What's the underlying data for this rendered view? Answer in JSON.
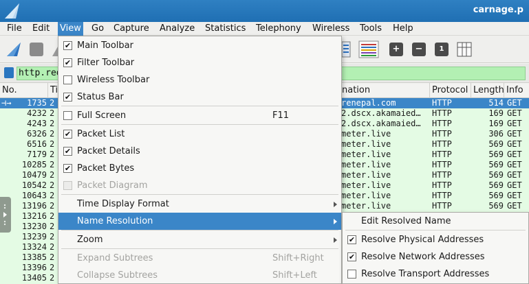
{
  "window": {
    "title": "carnage.p"
  },
  "menubar": {
    "items": [
      "File",
      "Edit",
      "View",
      "Go",
      "Capture",
      "Analyze",
      "Statistics",
      "Telephony",
      "Wireless",
      "Tools",
      "Help"
    ]
  },
  "filter": {
    "value": "http.requ"
  },
  "columns": {
    "no": "No.",
    "time": "Ti",
    "destination": "nation",
    "protocol": "Protocol",
    "length": "Length",
    "info": "Info"
  },
  "packets": [
    {
      "no": "1735",
      "time": "2",
      "dest": "renepal.com",
      "proto": "HTTP",
      "len": "514",
      "info": "GET"
    },
    {
      "no": "4232",
      "time": "2",
      "dest": "2.dscx.akamaied…",
      "proto": "HTTP",
      "len": "169",
      "info": "GET"
    },
    {
      "no": "4243",
      "time": "2",
      "dest": "2.dscx.akamaied…",
      "proto": "HTTP",
      "len": "169",
      "info": "GET"
    },
    {
      "no": "6326",
      "time": "2",
      "dest": "meter.live",
      "proto": "HTTP",
      "len": "306",
      "info": "GET"
    },
    {
      "no": "6516",
      "time": "2",
      "dest": "meter.live",
      "proto": "HTTP",
      "len": "569",
      "info": "GET"
    },
    {
      "no": "7179",
      "time": "2",
      "dest": "meter.live",
      "proto": "HTTP",
      "len": "569",
      "info": "GET"
    },
    {
      "no": "10285",
      "time": "2",
      "dest": "meter.live",
      "proto": "HTTP",
      "len": "569",
      "info": "GET"
    },
    {
      "no": "10479",
      "time": "2",
      "dest": "meter.live",
      "proto": "HTTP",
      "len": "569",
      "info": "GET"
    },
    {
      "no": "10542",
      "time": "2",
      "dest": "meter.live",
      "proto": "HTTP",
      "len": "569",
      "info": "GET"
    },
    {
      "no": "10643",
      "time": "2",
      "dest": "meter.live",
      "proto": "HTTP",
      "len": "569",
      "info": "GET"
    },
    {
      "no": "13196",
      "time": "2",
      "dest": "meter.live",
      "proto": "HTTP",
      "len": "569",
      "info": "GET"
    },
    {
      "no": "13216",
      "time": "2",
      "dest": "",
      "proto": "",
      "len": "",
      "info": ""
    },
    {
      "no": "13230",
      "time": "2",
      "dest": "",
      "proto": "",
      "len": "",
      "info": ""
    },
    {
      "no": "13239",
      "time": "2",
      "dest": "",
      "proto": "",
      "len": "",
      "info": ""
    },
    {
      "no": "13324",
      "time": "2",
      "dest": "",
      "proto": "",
      "len": "",
      "info": ""
    },
    {
      "no": "13385",
      "time": "2",
      "dest": "",
      "proto": "",
      "len": "",
      "info": ""
    },
    {
      "no": "13396",
      "time": "2",
      "dest": "",
      "proto": "",
      "len": "",
      "info": ""
    },
    {
      "no": "13405",
      "time": "2",
      "dest": "",
      "proto": "",
      "len": "",
      "info": ""
    }
  ],
  "view_menu": {
    "main_toolbar": "Main Toolbar",
    "filter_toolbar": "Filter Toolbar",
    "wireless_toolbar": "Wireless Toolbar",
    "status_bar": "Status Bar",
    "full_screen": "Full Screen",
    "full_screen_shortcut": "F11",
    "packet_list": "Packet List",
    "packet_details": "Packet Details",
    "packet_bytes": "Packet Bytes",
    "packet_diagram": "Packet Diagram",
    "time_display_format": "Time Display Format",
    "name_resolution": "Name Resolution",
    "zoom": "Zoom",
    "expand_subtrees": "Expand Subtrees",
    "expand_subtrees_shortcut": "Shift+Right",
    "collapse_subtrees": "Collapse Subtrees",
    "collapse_subtrees_shortcut": "Shift+Left"
  },
  "name_resolution_menu": {
    "edit_resolved_name": "Edit Resolved Name",
    "resolve_physical": "Resolve Physical Addresses",
    "resolve_network": "Resolve Network Addresses",
    "resolve_transport": "Resolve Transport Addresses"
  },
  "toolbar_icons": {
    "zoom_in": "+",
    "zoom_out": "−",
    "zoom_normal": "1"
  },
  "colors": {
    "titlebar": "#1f6fb3",
    "highlight": "#3b86c8",
    "packet_row_bg": "#e4fbe4",
    "filter_bg": "#b3f0b3"
  }
}
